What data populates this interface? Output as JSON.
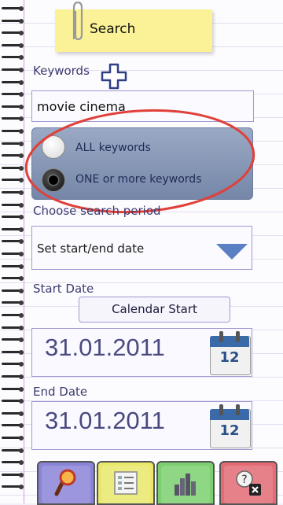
{
  "header": {
    "title": "Search"
  },
  "keywords": {
    "label": "Keywords",
    "value": "movie cinema"
  },
  "match_mode": {
    "options": [
      "ALL keywords",
      "ONE or more keywords"
    ],
    "selected": "ONE or more keywords"
  },
  "period": {
    "label": "Choose search period",
    "selected": "Set start/end date"
  },
  "start": {
    "label": "Start Date",
    "button": "Calendar Start",
    "value": "31.01.2011",
    "calendar_day": "12"
  },
  "end": {
    "label": "End Date",
    "value": "31.01.2011",
    "calendar_day": "12"
  },
  "colors": {
    "accent": "#5a7fc2",
    "highlight_ellipse": "#e0403a",
    "sticky_note": "#fbf297"
  },
  "toolbar": {
    "icons": [
      "magnifier-icon",
      "list-icon",
      "bar-chart-icon",
      "help-close-icon"
    ]
  }
}
